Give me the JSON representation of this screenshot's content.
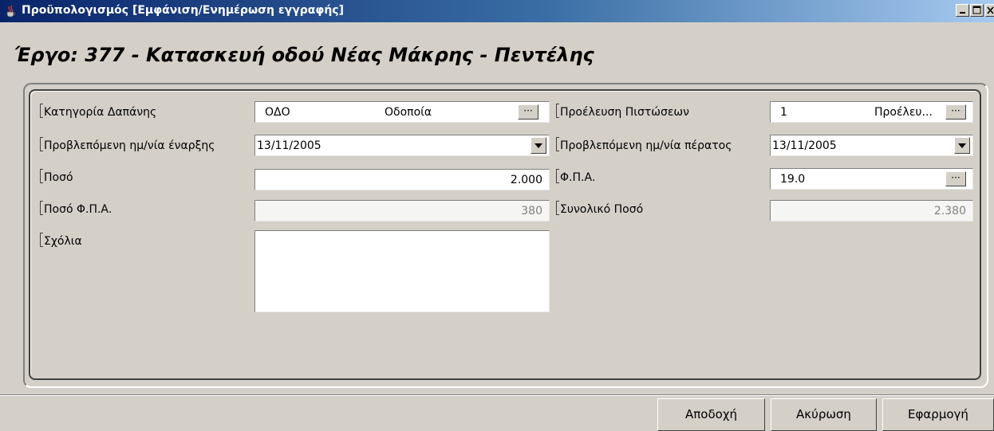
{
  "window": {
    "title": "Προϋπολογισμός [Εμφάνιση/Ενημέρωση  εγγραφής]",
    "icon": "java-cup-icon",
    "controls": [
      "minimize-icon",
      "maximize-icon",
      "close-icon"
    ]
  },
  "heading": "Έργο: 377 - Κατασκευή οδού Νέας Μάκρης - Πεντέλης",
  "form": {
    "category_label": "Κατηγορία Δαπάνης",
    "category_code": "ΟΔΟ",
    "category_name": "Οδοποία",
    "category_button": "···",
    "start_date_label": "Προβλεπόμενη ημ/νία έναρξης",
    "start_date_value": "13/11/2005",
    "amount_label": "Ποσό",
    "amount_value": "2.000",
    "vat_amount_label": "Ποσό Φ.Π.Α.",
    "vat_amount_value": "380",
    "comments_label": "Σχόλια",
    "comments_value": "",
    "source_label": "Προέλευση Πιστώσεων",
    "source_code": "1",
    "source_name": "Προέλευ...",
    "source_button": "···",
    "end_date_label": "Προβλεπόμενη ημ/νία πέρατος",
    "end_date_value": "13/11/2005",
    "vat_label": "Φ.Π.Α.",
    "vat_value": "19.0",
    "vat_button": "···",
    "total_label": "Συνολικό Ποσό",
    "total_value": "2.380"
  },
  "buttons": {
    "accept": "Αποδοχή",
    "cancel": "Ακύρωση",
    "apply": "Εφαρμογή"
  }
}
